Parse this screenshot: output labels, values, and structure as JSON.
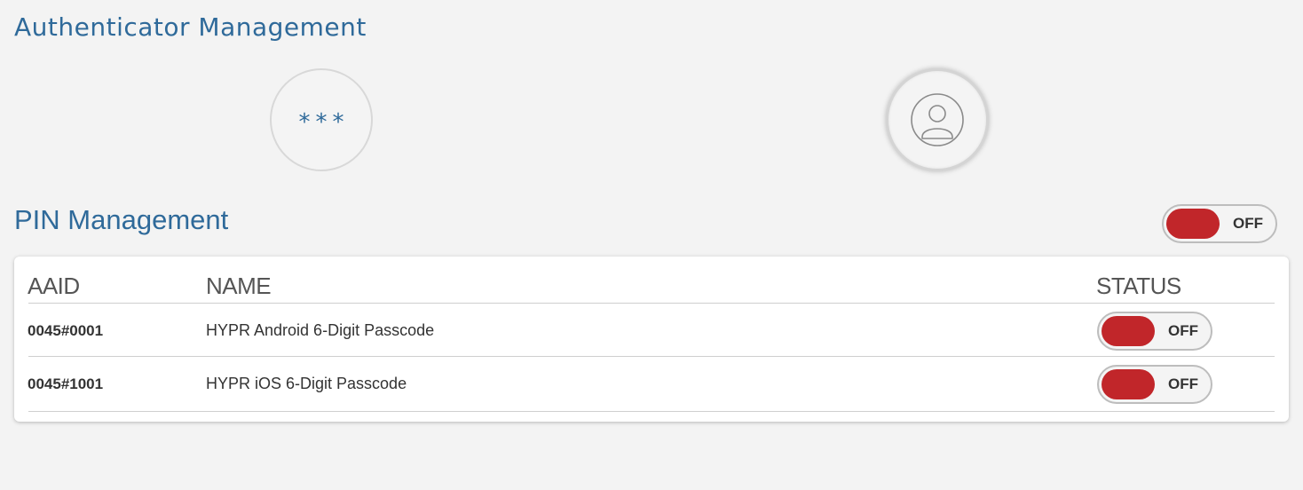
{
  "page_title": "Authenticator Management",
  "authenticators": [
    {
      "icon": "pin-asterisks-icon",
      "glyph": "***"
    },
    {
      "icon": "user-profile-icon"
    }
  ],
  "pin_section": {
    "title": "PIN Management",
    "toggle_state": "OFF"
  },
  "table": {
    "headers": {
      "aaid": "AAID",
      "name": "NAME",
      "status": "STATUS"
    },
    "rows": [
      {
        "aaid": "0045#0001",
        "name": "HYPR Android 6-Digit Passcode",
        "status": "OFF"
      },
      {
        "aaid": "0045#1001",
        "name": "HYPR iOS 6-Digit Passcode",
        "status": "OFF"
      }
    ]
  },
  "colors": {
    "accent": "#2f6a9a",
    "toggle_off": "#c1262a",
    "background": "#f3f3f3"
  }
}
